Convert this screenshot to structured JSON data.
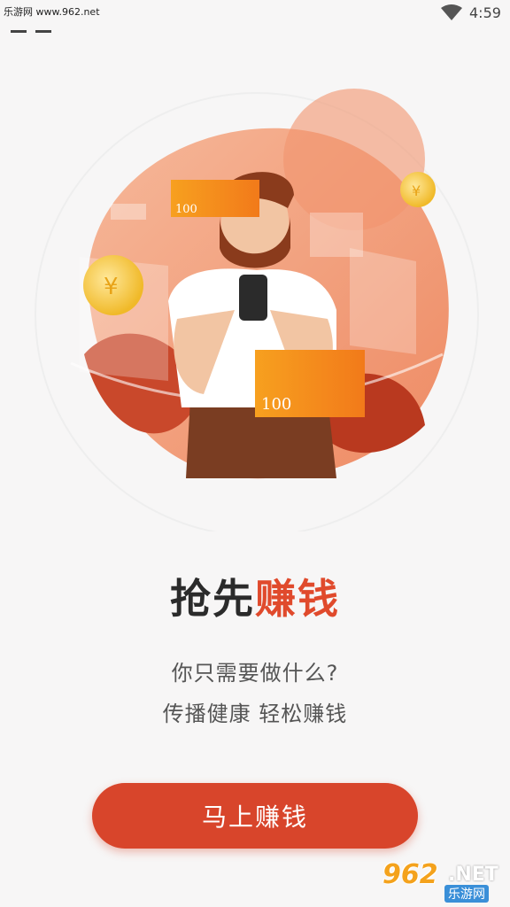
{
  "status_bar": {
    "watermark_text": "乐游网 www.962.net",
    "time": "4:59",
    "wifi_icon": "wifi-icon"
  },
  "illustration": {
    "banknote_top": "100",
    "banknote_bottom": "100",
    "coin_symbol": "¥"
  },
  "headline": {
    "part1": "抢先",
    "part2": "赚钱"
  },
  "subtitle": {
    "line1": "你只需要做什么?",
    "line2": "传播健康 轻松赚钱"
  },
  "cta": {
    "label": "马上赚钱"
  },
  "watermark": {
    "number": "962",
    "net": ".NET",
    "cn": "乐游网"
  },
  "colors": {
    "accent": "#e04a2c",
    "button": "#d8452b",
    "background": "#f7f6f6"
  }
}
